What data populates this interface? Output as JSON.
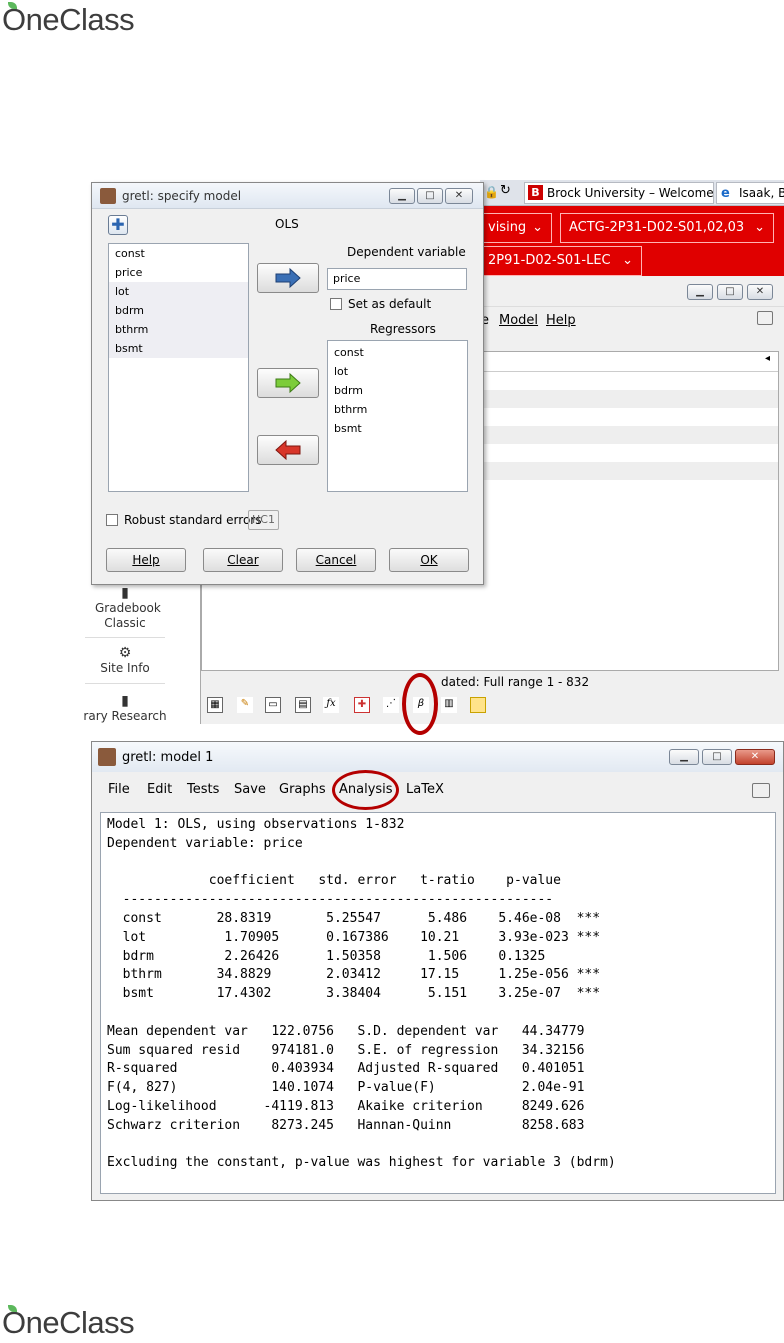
{
  "brand": {
    "name": "OneClass"
  },
  "browser": {
    "tabs": [
      {
        "badge": "B",
        "label": "Brock University – Welcome to..."
      },
      {
        "badge": "e",
        "label": "Isaak, Br"
      }
    ],
    "course_menus": [
      {
        "label": "vising"
      },
      {
        "label": "ACTG-2P31-D02-S01,02,03"
      },
      {
        "label": "2P91-D02-S01-LEC"
      }
    ],
    "sidebar": [
      {
        "label": "Gradebook Classic"
      },
      {
        "label": "Site Info"
      },
      {
        "label": "rary Research"
      }
    ]
  },
  "gretl_main": {
    "menu": [
      {
        "label": "e"
      },
      {
        "label": "Model"
      },
      {
        "label": "Help"
      }
    ],
    "status": "dated: Full range 1 - 832"
  },
  "specify_dialog": {
    "title": "gretl: specify model",
    "method": "OLS",
    "variables": [
      "const",
      "price",
      "lot",
      "bdrm",
      "bthrm",
      "bsmt"
    ],
    "dependent_label": "Dependent variable",
    "dependent_value": "price",
    "set_default_label": "Set as default",
    "regressors_label": "Regressors",
    "regressors": [
      "const",
      "lot",
      "bdrm",
      "bthrm",
      "bsmt"
    ],
    "robust_label": "Robust standard errors",
    "robust_option": "HC1",
    "buttons": {
      "help": "Help",
      "clear": "Clear",
      "cancel": "Cancel",
      "ok": "OK"
    }
  },
  "model_window": {
    "title": "gretl: model 1",
    "menu": [
      "File",
      "Edit",
      "Tests",
      "Save",
      "Graphs",
      "Analysis",
      "LaTeX"
    ],
    "output_lines": [
      "Model 1: OLS, using observations 1-832",
      "Dependent variable: price",
      "",
      "             coefficient   std. error   t-ratio    p-value",
      "  -------------------------------------------------------",
      "  const       28.8319       5.25547      5.486    5.46e-08  ***",
      "  lot          1.70905      0.167386    10.21     3.93e-023 ***",
      "  bdrm         2.26426      1.50358      1.506    0.1325",
      "  bthrm       34.8829       2.03412     17.15     1.25e-056 ***",
      "  bsmt        17.4302       3.38404      5.151    3.25e-07  ***",
      "",
      "Mean dependent var   122.0756   S.D. dependent var   44.34779",
      "Sum squared resid    974181.0   S.E. of regression   34.32156",
      "R-squared            0.403934   Adjusted R-squared   0.401051",
      "F(4, 827)            140.1074   P-value(F)           2.04e-91",
      "Log-likelihood      -4119.813   Akaike criterion     8249.626",
      "Schwarz criterion    8273.245   Hannan-Quinn         8258.683",
      "",
      "Excluding the constant, p-value was highest for variable 3 (bdrm)"
    ]
  },
  "colors": {
    "brand_green": "#5cb85c",
    "lms_red": "#e00000",
    "highlight_red": "#b40000"
  }
}
